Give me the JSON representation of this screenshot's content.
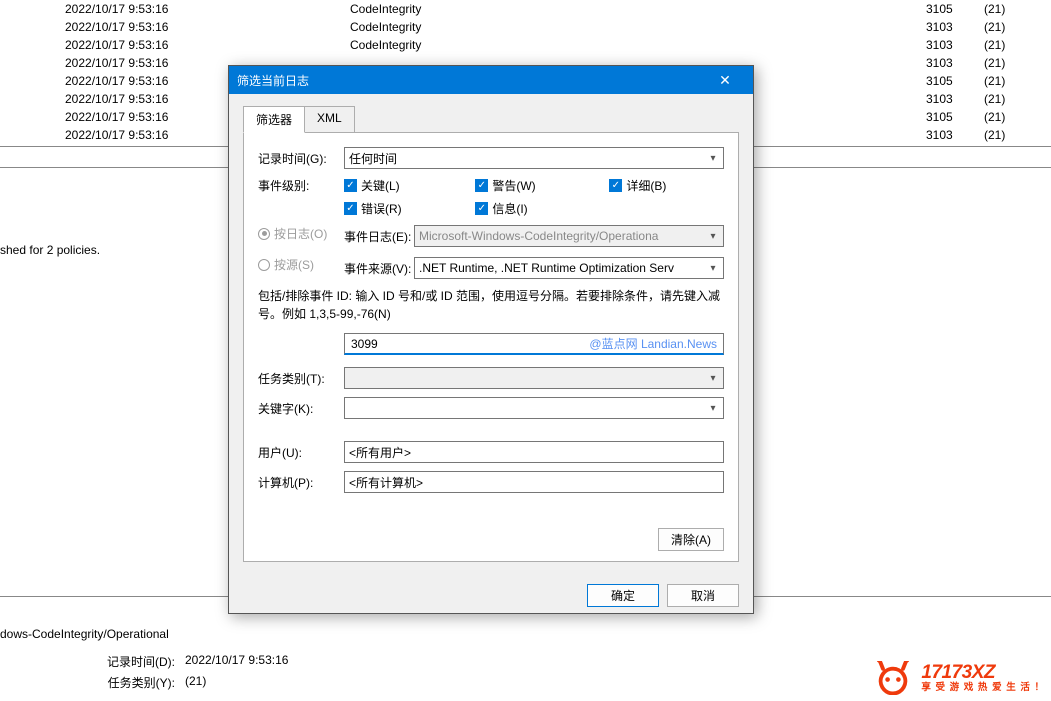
{
  "log": {
    "rows": [
      {
        "date": "2022/10/17 9:53:16",
        "source": "CodeIntegrity",
        "id": "3105",
        "task": "(21)"
      },
      {
        "date": "2022/10/17 9:53:16",
        "source": "CodeIntegrity",
        "id": "3103",
        "task": "(21)"
      },
      {
        "date": "2022/10/17 9:53:16",
        "source": "CodeIntegrity",
        "id": "3103",
        "task": "(21)"
      },
      {
        "date": "2022/10/17 9:53:16",
        "source": "",
        "id": "3103",
        "task": "(21)"
      },
      {
        "date": "2022/10/17 9:53:16",
        "source": "",
        "id": "3105",
        "task": "(21)"
      },
      {
        "date": "2022/10/17 9:53:16",
        "source": "",
        "id": "3103",
        "task": "(21)"
      },
      {
        "date": "2022/10/17 9:53:16",
        "source": "",
        "id": "3105",
        "task": "(21)"
      },
      {
        "date": "2022/10/17 9:53:16",
        "source": "",
        "id": "3103",
        "task": "(21)"
      }
    ],
    "status": "shed for 2 policies.",
    "src_line": "dows-CodeIntegrity/Operational",
    "detail_time_label": "记录时间(D):",
    "detail_time_val": "2022/10/17 9:53:16",
    "detail_task_label": "任务类别(Y):",
    "detail_task_val": "(21)"
  },
  "dialog": {
    "title": "筛选当前日志",
    "tabs": {
      "filter": "筛选器",
      "xml": "XML"
    },
    "labels": {
      "logged": "记录时间(G):",
      "level": "事件级别:",
      "by_log": "按日志(O)",
      "by_source": "按源(S)",
      "event_log": "事件日志(E):",
      "event_source": "事件来源(V):",
      "note": "包括/排除事件 ID: 输入 ID 号和/或 ID 范围，使用逗号分隔。若要排除条件，请先键入减号。例如 1,3,5-99,-76(N)",
      "task_cat": "任务类别(T):",
      "keywords": "关键字(K):",
      "user": "用户(U):",
      "computer": "计算机(P):",
      "clear": "清除(A)",
      "ok": "确定",
      "cancel": "取消"
    },
    "values": {
      "logged": "任何时间",
      "levels": {
        "critical": "关键(L)",
        "warning": "警告(W)",
        "verbose": "详细(B)",
        "error": "错误(R)",
        "info": "信息(I)"
      },
      "event_log": "Microsoft-Windows-CodeIntegrity/Operationa",
      "event_source": ".NET Runtime, .NET Runtime Optimization Serv",
      "id_input": "3099",
      "watermark": "@蓝点网 Landian.News",
      "user": "<所有用户>",
      "computer": "<所有计算机>"
    }
  },
  "wm": {
    "brand": "17173XZ",
    "slogan": "享 受 游 戏   热 爱 生 活 ！"
  }
}
